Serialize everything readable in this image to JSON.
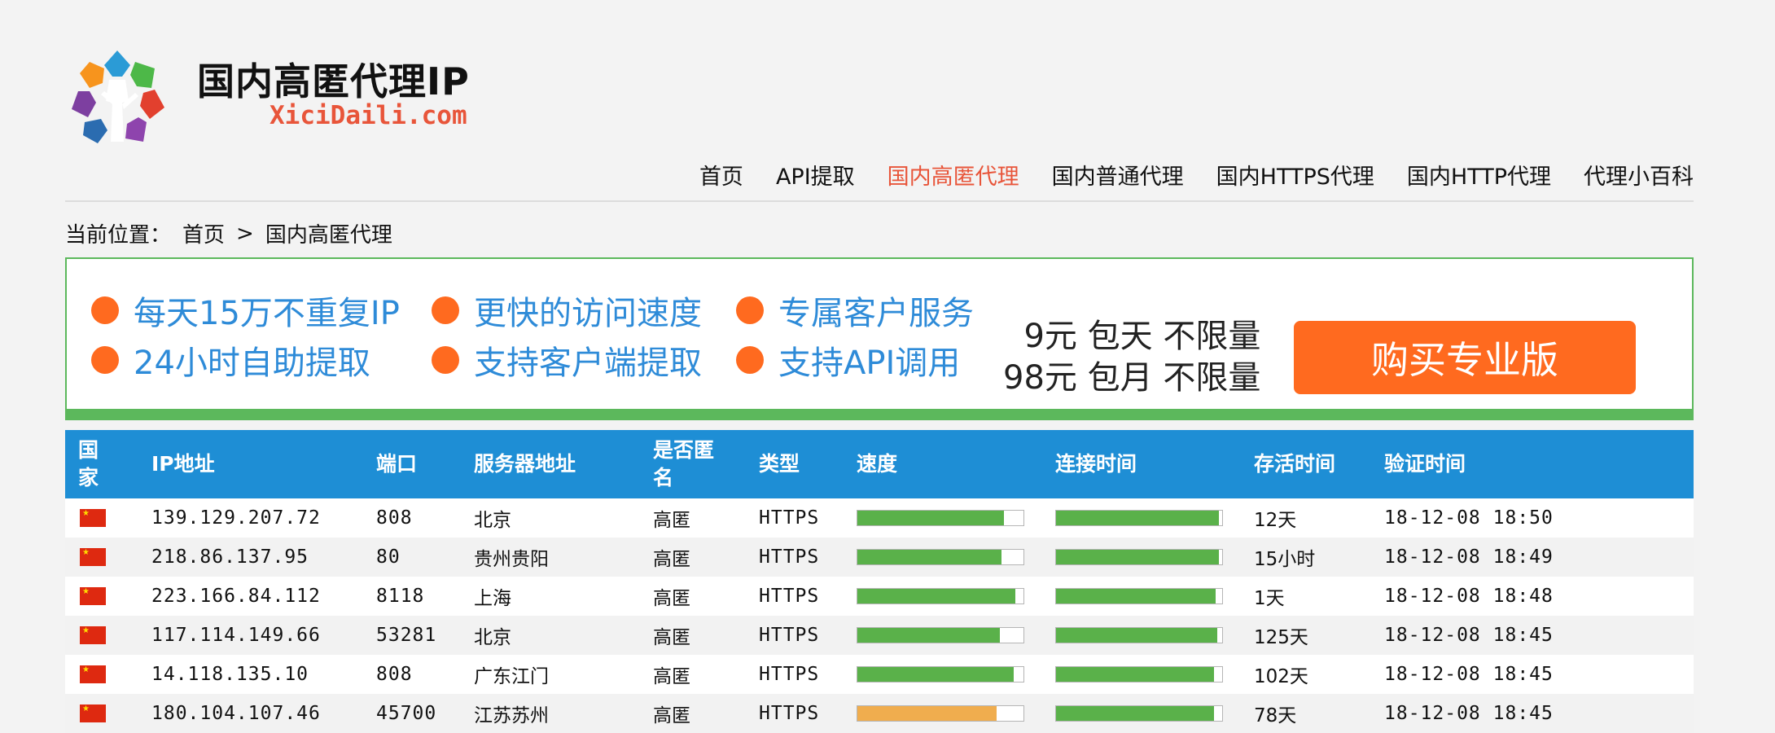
{
  "header": {
    "title": "国内高匿代理IP",
    "domain": "XiciDaili.com"
  },
  "nav": {
    "items": [
      {
        "label": "首页",
        "active": false
      },
      {
        "label": "API提取",
        "active": false
      },
      {
        "label": "国内高匿代理",
        "active": true
      },
      {
        "label": "国内普通代理",
        "active": false
      },
      {
        "label": "国内HTTPS代理",
        "active": false
      },
      {
        "label": "国内HTTP代理",
        "active": false
      },
      {
        "label": "代理小百科",
        "active": false
      }
    ]
  },
  "breadcrumb": {
    "prefix": "当前位置：",
    "home": "首页",
    "separator": ">",
    "current": "国内高匿代理"
  },
  "banner": {
    "features": [
      "每天15万不重复IP",
      "更快的访问速度",
      "专属客户服务",
      "24小时自助提取",
      "支持客户端提取",
      "支持API调用"
    ],
    "price_line1": "9元 包天 不限量",
    "price_line2": "98元 包月 不限量",
    "buy_label": "购买专业版",
    "colors": {
      "accent": "#ff6a1f",
      "feature_text": "#2e8bd8",
      "border": "#5cb85c"
    }
  },
  "table": {
    "headers": {
      "country": "国家",
      "ip": "IP地址",
      "port": "端口",
      "location": "服务器地址",
      "anonymous": "是否匿名",
      "type": "类型",
      "speed": "速度",
      "connect_time": "连接时间",
      "alive": "存活时间",
      "verified": "验证时间"
    },
    "rows": [
      {
        "country_icon": "china-flag-icon",
        "ip": "139.129.207.72",
        "port": "808",
        "location": "北京",
        "anonymous": "高匿",
        "type": "HTTPS",
        "speed_pct": 88,
        "speed_color": "#5ab14a",
        "connect_pct": 98,
        "connect_color": "#5ab14a",
        "alive": "12天",
        "verified": "18-12-08 18:50"
      },
      {
        "country_icon": "china-flag-icon",
        "ip": "218.86.137.95",
        "port": "80",
        "location": "贵州贵阳",
        "anonymous": "高匿",
        "type": "HTTPS",
        "speed_pct": 87,
        "speed_color": "#5ab14a",
        "connect_pct": 98,
        "connect_color": "#5ab14a",
        "alive": "15小时",
        "verified": "18-12-08 18:49"
      },
      {
        "country_icon": "china-flag-icon",
        "ip": "223.166.84.112",
        "port": "8118",
        "location": "上海",
        "anonymous": "高匿",
        "type": "HTTPS",
        "speed_pct": 95,
        "speed_color": "#5ab14a",
        "connect_pct": 96,
        "connect_color": "#5ab14a",
        "alive": "1天",
        "verified": "18-12-08 18:48"
      },
      {
        "country_icon": "china-flag-icon",
        "ip": "117.114.149.66",
        "port": "53281",
        "location": "北京",
        "anonymous": "高匿",
        "type": "HTTPS",
        "speed_pct": 86,
        "speed_color": "#5ab14a",
        "connect_pct": 97,
        "connect_color": "#5ab14a",
        "alive": "125天",
        "verified": "18-12-08 18:45"
      },
      {
        "country_icon": "china-flag-icon",
        "ip": "14.118.135.10",
        "port": "808",
        "location": "广东江门",
        "anonymous": "高匿",
        "type": "HTTPS",
        "speed_pct": 94,
        "speed_color": "#5ab14a",
        "connect_pct": 95,
        "connect_color": "#5ab14a",
        "alive": "102天",
        "verified": "18-12-08 18:45"
      },
      {
        "country_icon": "china-flag-icon",
        "ip": "180.104.107.46",
        "port": "45700",
        "location": "江苏苏州",
        "anonymous": "高匿",
        "type": "HTTPS",
        "speed_pct": 84,
        "speed_color": "#f0ad4e",
        "connect_pct": 95,
        "connect_color": "#5ab14a",
        "alive": "78天",
        "verified": "18-12-08 18:45"
      }
    ]
  }
}
